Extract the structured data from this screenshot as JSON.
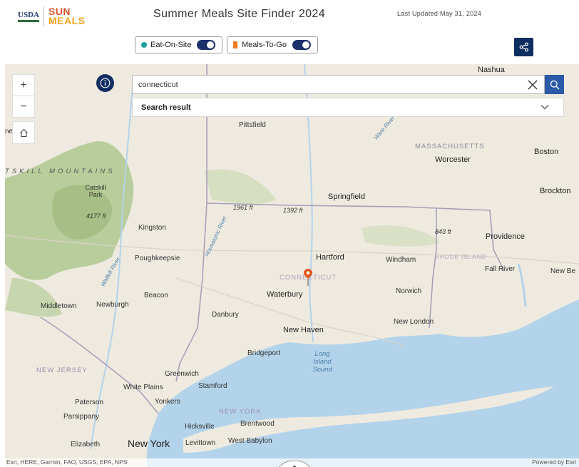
{
  "header": {
    "logo_usda": "USDA",
    "logo_sun": "SUN",
    "logo_meals": "MEALS",
    "title": "Summer Meals Site Finder 2024",
    "updated": "Last Updated May 31, 2024"
  },
  "filters": [
    {
      "label": "Eat-On-Site",
      "enabled": true,
      "color": "#1aa39a"
    },
    {
      "label": "Meals-To-Go",
      "enabled": true,
      "color": "#f27b21"
    }
  ],
  "search": {
    "value": "connecticut",
    "results_label": "Search result"
  },
  "map": {
    "labels": {
      "nashua": "Nashua",
      "pittsfield": "Pittsfield",
      "massachusetts": "MASSACHUSETTS",
      "boston": "Boston",
      "worcester": "Worcester",
      "catskill_mtns": "TSKILL MOUNTAINS",
      "catskill_park": "Catskill Park",
      "elev_4177": "4177 ft",
      "brockton": "Brockton",
      "springfield": "Springfield",
      "elev_1961": "1961 ft",
      "elev_1392": "1392 ft",
      "elev_843": "843 ft",
      "kingston": "Kingston",
      "providence": "Providence",
      "poughkeepsie": "Poughkeepsie",
      "hartford": "Hartford",
      "windham": "Windham",
      "rhode_island": "RHODE ISLAND",
      "connecticut": "CONNECTICUT",
      "fall_river": "Fall River",
      "new_bedford": "New Be",
      "waterbury": "Waterbury",
      "beacon": "Beacon",
      "norwich": "Norwich",
      "middletown": "Middletown",
      "newburgh": "Newburgh",
      "danbury": "Danbury",
      "new_london": "New London",
      "new_haven": "New Haven",
      "bridgeport": "Bridgeport",
      "long_island_sound": "Long Island Sound",
      "new_jersey": "NEW JERSEY",
      "greenwich": "Greenwich",
      "white_plains": "White Plains",
      "stamford": "Stamford",
      "paterson": "Paterson",
      "yonkers": "Yonkers",
      "new_york_state": "NEW YORK",
      "parsippany": "Parsippany",
      "hicksville": "Hicksville",
      "brentwood": "Brentwood",
      "elizabeth": "Elizabeth",
      "new_york": "New York",
      "levittown": "Levittown",
      "west_babylon": "West Babylon",
      "ware_river": "Ware River",
      "housatonic_river": "Housatonic River",
      "wallkill_river": "Wallkill River",
      "partial_left": "ne"
    },
    "attribution_left": "Esri, HERE, Garmin, FAO, USGS, EPA, NPS",
    "attribution_right": "Powered by Esri",
    "marker": "location-pin"
  },
  "colors": {
    "navy": "#112e63",
    "accent_blue": "#2b5aa8",
    "water": "#b3d3ea",
    "land": "#eeeae0",
    "forest": "#a7c08a"
  }
}
